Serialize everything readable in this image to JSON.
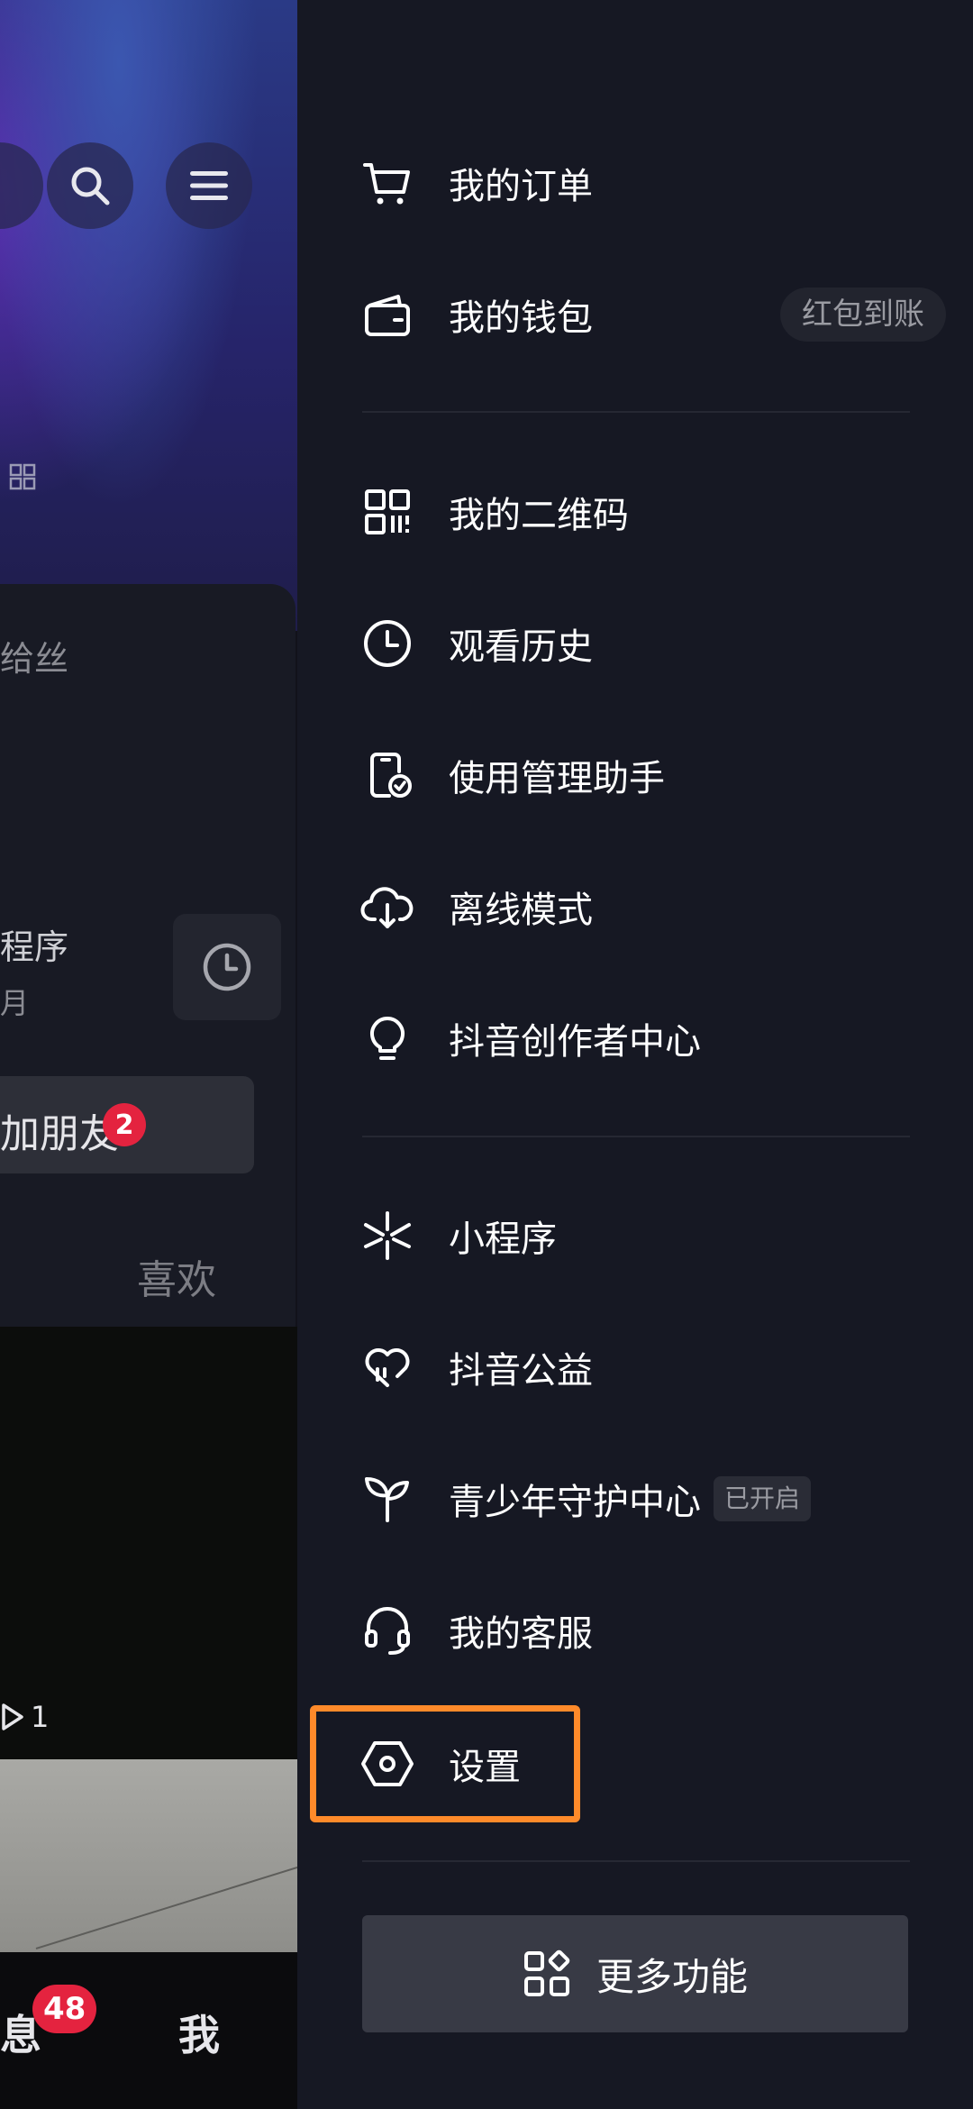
{
  "left_page": {
    "fans_partial": "给丝",
    "mini_program_partial": "程序",
    "mini_program_sub_partial": "月",
    "friends_partial": "加朋友",
    "friends_badge": "2",
    "like_tab": "喜欢",
    "view_count": "1",
    "nav": {
      "messages_partial": "消息",
      "messages_badge": "48",
      "me": "我"
    }
  },
  "drawer": {
    "items": [
      {
        "label": "我的订单",
        "icon": "cart-icon"
      },
      {
        "label": "我的钱包",
        "icon": "wallet-icon",
        "pill": "红包到账"
      },
      {
        "label": "我的二维码",
        "icon": "qr-code-icon"
      },
      {
        "label": "观看历史",
        "icon": "clock-icon"
      },
      {
        "label": "使用管理助手",
        "icon": "phone-check-icon"
      },
      {
        "label": "离线模式",
        "icon": "cloud-download-icon"
      },
      {
        "label": "抖音创作者中心",
        "icon": "lightbulb-icon"
      },
      {
        "label": "小程序",
        "icon": "mini-program-icon"
      },
      {
        "label": "抖音公益",
        "icon": "heart-icon"
      },
      {
        "label": "青少年守护中心",
        "icon": "sprout-icon",
        "tag": "已开启"
      },
      {
        "label": "我的客服",
        "icon": "headset-icon"
      },
      {
        "label": "设置",
        "icon": "settings-hexagon-icon"
      }
    ],
    "more_button": "更多功能"
  },
  "colors": {
    "drawer_bg": "#161823",
    "highlight": "#ff8a2a",
    "badge": "#e4233f"
  }
}
